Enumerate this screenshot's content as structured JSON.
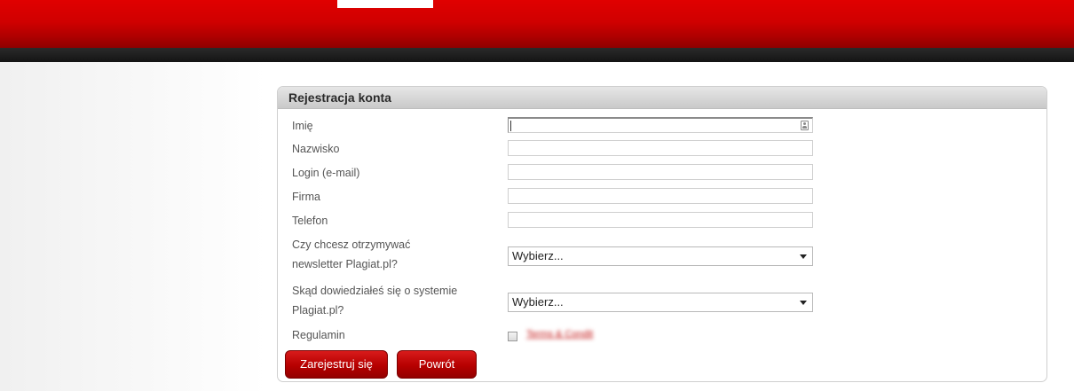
{
  "form": {
    "title": "Rejestracja konta",
    "fields": {
      "first_name": {
        "label": "Imię",
        "value": ""
      },
      "last_name": {
        "label": "Nazwisko",
        "value": ""
      },
      "login": {
        "label": "Login (e-mail)",
        "value": ""
      },
      "company": {
        "label": "Firma",
        "value": ""
      },
      "phone": {
        "label": "Telefon",
        "value": ""
      }
    },
    "newsletter": {
      "label_line1": "Czy chcesz otrzymywać",
      "label_line2": "newsletter Plagiat.pl?",
      "selected": "Wybierz..."
    },
    "source": {
      "label_line1": "Skąd dowiedziałeś się o systemie",
      "label_line2": "Plagiat.pl?",
      "selected": "Wybierz..."
    },
    "terms": {
      "label": "Regulamin",
      "link_text": "Terms & Condit",
      "checked": false
    },
    "buttons": {
      "register": "Zarejestruj się",
      "back": "Powrót"
    }
  },
  "colors": {
    "brand_red": "#c80000",
    "dark_strip": "#1e1e1e"
  },
  "icons": {
    "autofill": "contact-card-icon",
    "dropdown": "chevron-down-icon"
  }
}
